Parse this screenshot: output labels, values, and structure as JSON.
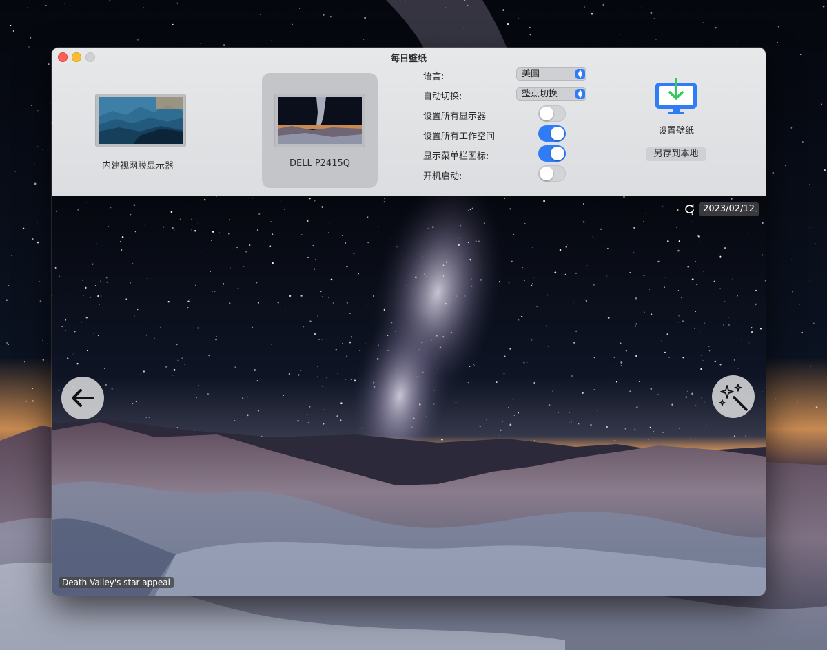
{
  "window": {
    "title": "每日壁纸"
  },
  "displays": [
    {
      "label": "内建视网膜显示器",
      "selected": false,
      "thumb": "blue-mountains"
    },
    {
      "label": "DELL P2415Q",
      "selected": true,
      "thumb": "milky-way"
    }
  ],
  "settings": {
    "language": {
      "label": "语言:",
      "value": "美国"
    },
    "auto_switch": {
      "label": "自动切换:",
      "value": "整点切换"
    },
    "toggles": [
      {
        "label": "设置所有显示器",
        "on": false
      },
      {
        "label": "设置所有工作空间",
        "on": true
      },
      {
        "label": "显示菜单栏图标:",
        "on": true
      },
      {
        "label": "开机启动:",
        "on": false
      }
    ]
  },
  "actions": {
    "set_wallpaper_label": "设置壁纸",
    "save_local_label": "另存到本地"
  },
  "preview": {
    "date": "2023/02/12",
    "caption": "Death Valley's star appeal"
  },
  "colors": {
    "accent": "#2f7cf6",
    "download_arrow": "#34c759"
  },
  "icons": {
    "refresh": "refresh-icon",
    "back": "arrow-left-icon",
    "magic": "magic-wand-icon",
    "set_wallpaper": "monitor-download-icon"
  }
}
